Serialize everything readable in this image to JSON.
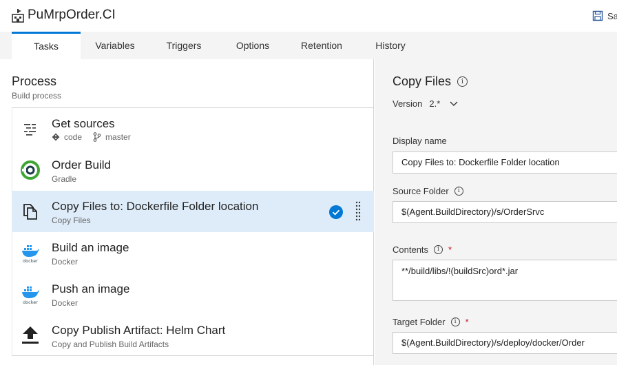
{
  "header": {
    "title": "PuMrpOrder.CI",
    "save_label": "Sa"
  },
  "tabs": [
    {
      "label": "Tasks",
      "active": true
    },
    {
      "label": "Variables"
    },
    {
      "label": "Triggers"
    },
    {
      "label": "Options"
    },
    {
      "label": "Retention"
    },
    {
      "label": "History"
    }
  ],
  "process": {
    "title": "Process",
    "subtitle": "Build process"
  },
  "tasks": [
    {
      "name": "Get sources",
      "repo": "code",
      "branch": "master",
      "icon": "get-sources-icon"
    },
    {
      "name": "Order Build",
      "subtitle": "Gradle",
      "icon": "gradle-icon"
    },
    {
      "name": "Copy Files to: Dockerfile Folder location",
      "subtitle": "Copy Files",
      "icon": "copy-files-icon",
      "selected": true
    },
    {
      "name": "Build an image",
      "subtitle": "Docker",
      "icon": "docker-icon"
    },
    {
      "name": "Push an image",
      "subtitle": "Docker",
      "icon": "docker-icon"
    },
    {
      "name": "Copy Publish Artifact: Helm Chart",
      "subtitle": "Copy and Publish Build Artifacts",
      "icon": "upload-icon"
    }
  ],
  "docker_label": "docker",
  "details": {
    "title": "Copy Files",
    "version_label": "Version",
    "version_value": "2.*",
    "display_name_label": "Display name",
    "display_name_value": "Copy Files to: Dockerfile Folder location",
    "source_folder_label": "Source Folder",
    "source_folder_value": "$(Agent.BuildDirectory)/s/OrderSrvc",
    "contents_label": "Contents",
    "contents_value": "**/build/libs/!(buildSrc)ord*.jar",
    "target_folder_label": "Target Folder",
    "target_folder_value": "$(Agent.BuildDirectory)/s/deploy/docker/Order",
    "required_marker": "*",
    "info_glyph": "i"
  },
  "colors": {
    "accent": "#0078d4",
    "selected_row": "#deecf9",
    "gradle_green": "#3fa535",
    "docker_blue": "#2496ed",
    "required_red": "#c50f1f"
  }
}
